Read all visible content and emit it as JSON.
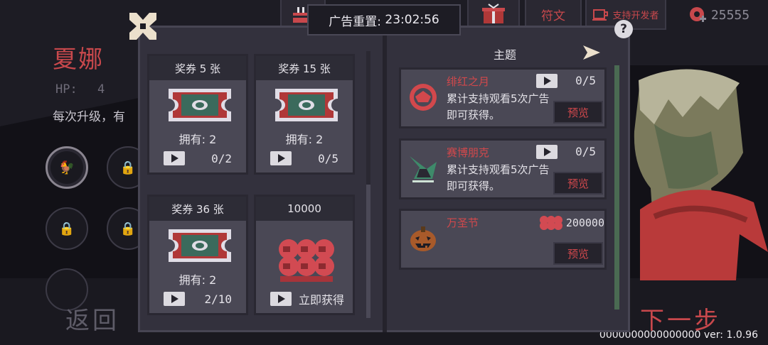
{
  "background": {
    "character_name": "夏娜",
    "hp_label": "HP:",
    "hp_value": "4",
    "description": "每次升级，有",
    "back_label": "返回",
    "next_label": "下一步",
    "version": "0000000000000000 ver: 1.0.96"
  },
  "topbar": {
    "rune_label": "符文",
    "support_label": "支持开发者",
    "coins": "25555"
  },
  "ad_timer": {
    "label": "广告重置:",
    "value": "23:02:56"
  },
  "coupons": [
    {
      "title": "奖券 5 张",
      "owned_label": "拥有:",
      "owned": "2",
      "progress": "0/2"
    },
    {
      "title": "奖券 15 张",
      "owned_label": "拥有:",
      "owned": "2",
      "progress": "0/5"
    },
    {
      "title": "奖券 36 张",
      "owned_label": "拥有:",
      "owned": "2",
      "progress": "2/10"
    }
  ],
  "coin_offer": {
    "title": "10000",
    "action": "立即获得"
  },
  "themes": {
    "header": "主题",
    "items": [
      {
        "name": "绯红之月",
        "desc": "累计支持观看5次广告即可获得。",
        "progress": "0/5",
        "preview": "预览",
        "icon": "crimson-moon-icon"
      },
      {
        "name": "赛博朋克",
        "desc": "累计支持观看5次广告即可获得。",
        "progress": "0/5",
        "preview": "预览",
        "icon": "cyberpunk-crow-icon"
      },
      {
        "name": "万圣节",
        "price": "200000",
        "preview": "预览",
        "icon": "pumpkin-icon"
      }
    ]
  },
  "colors": {
    "accent_red": "#c8484c",
    "panel": "#33313d",
    "card": "#4a4855",
    "header": "#2d2c36"
  }
}
